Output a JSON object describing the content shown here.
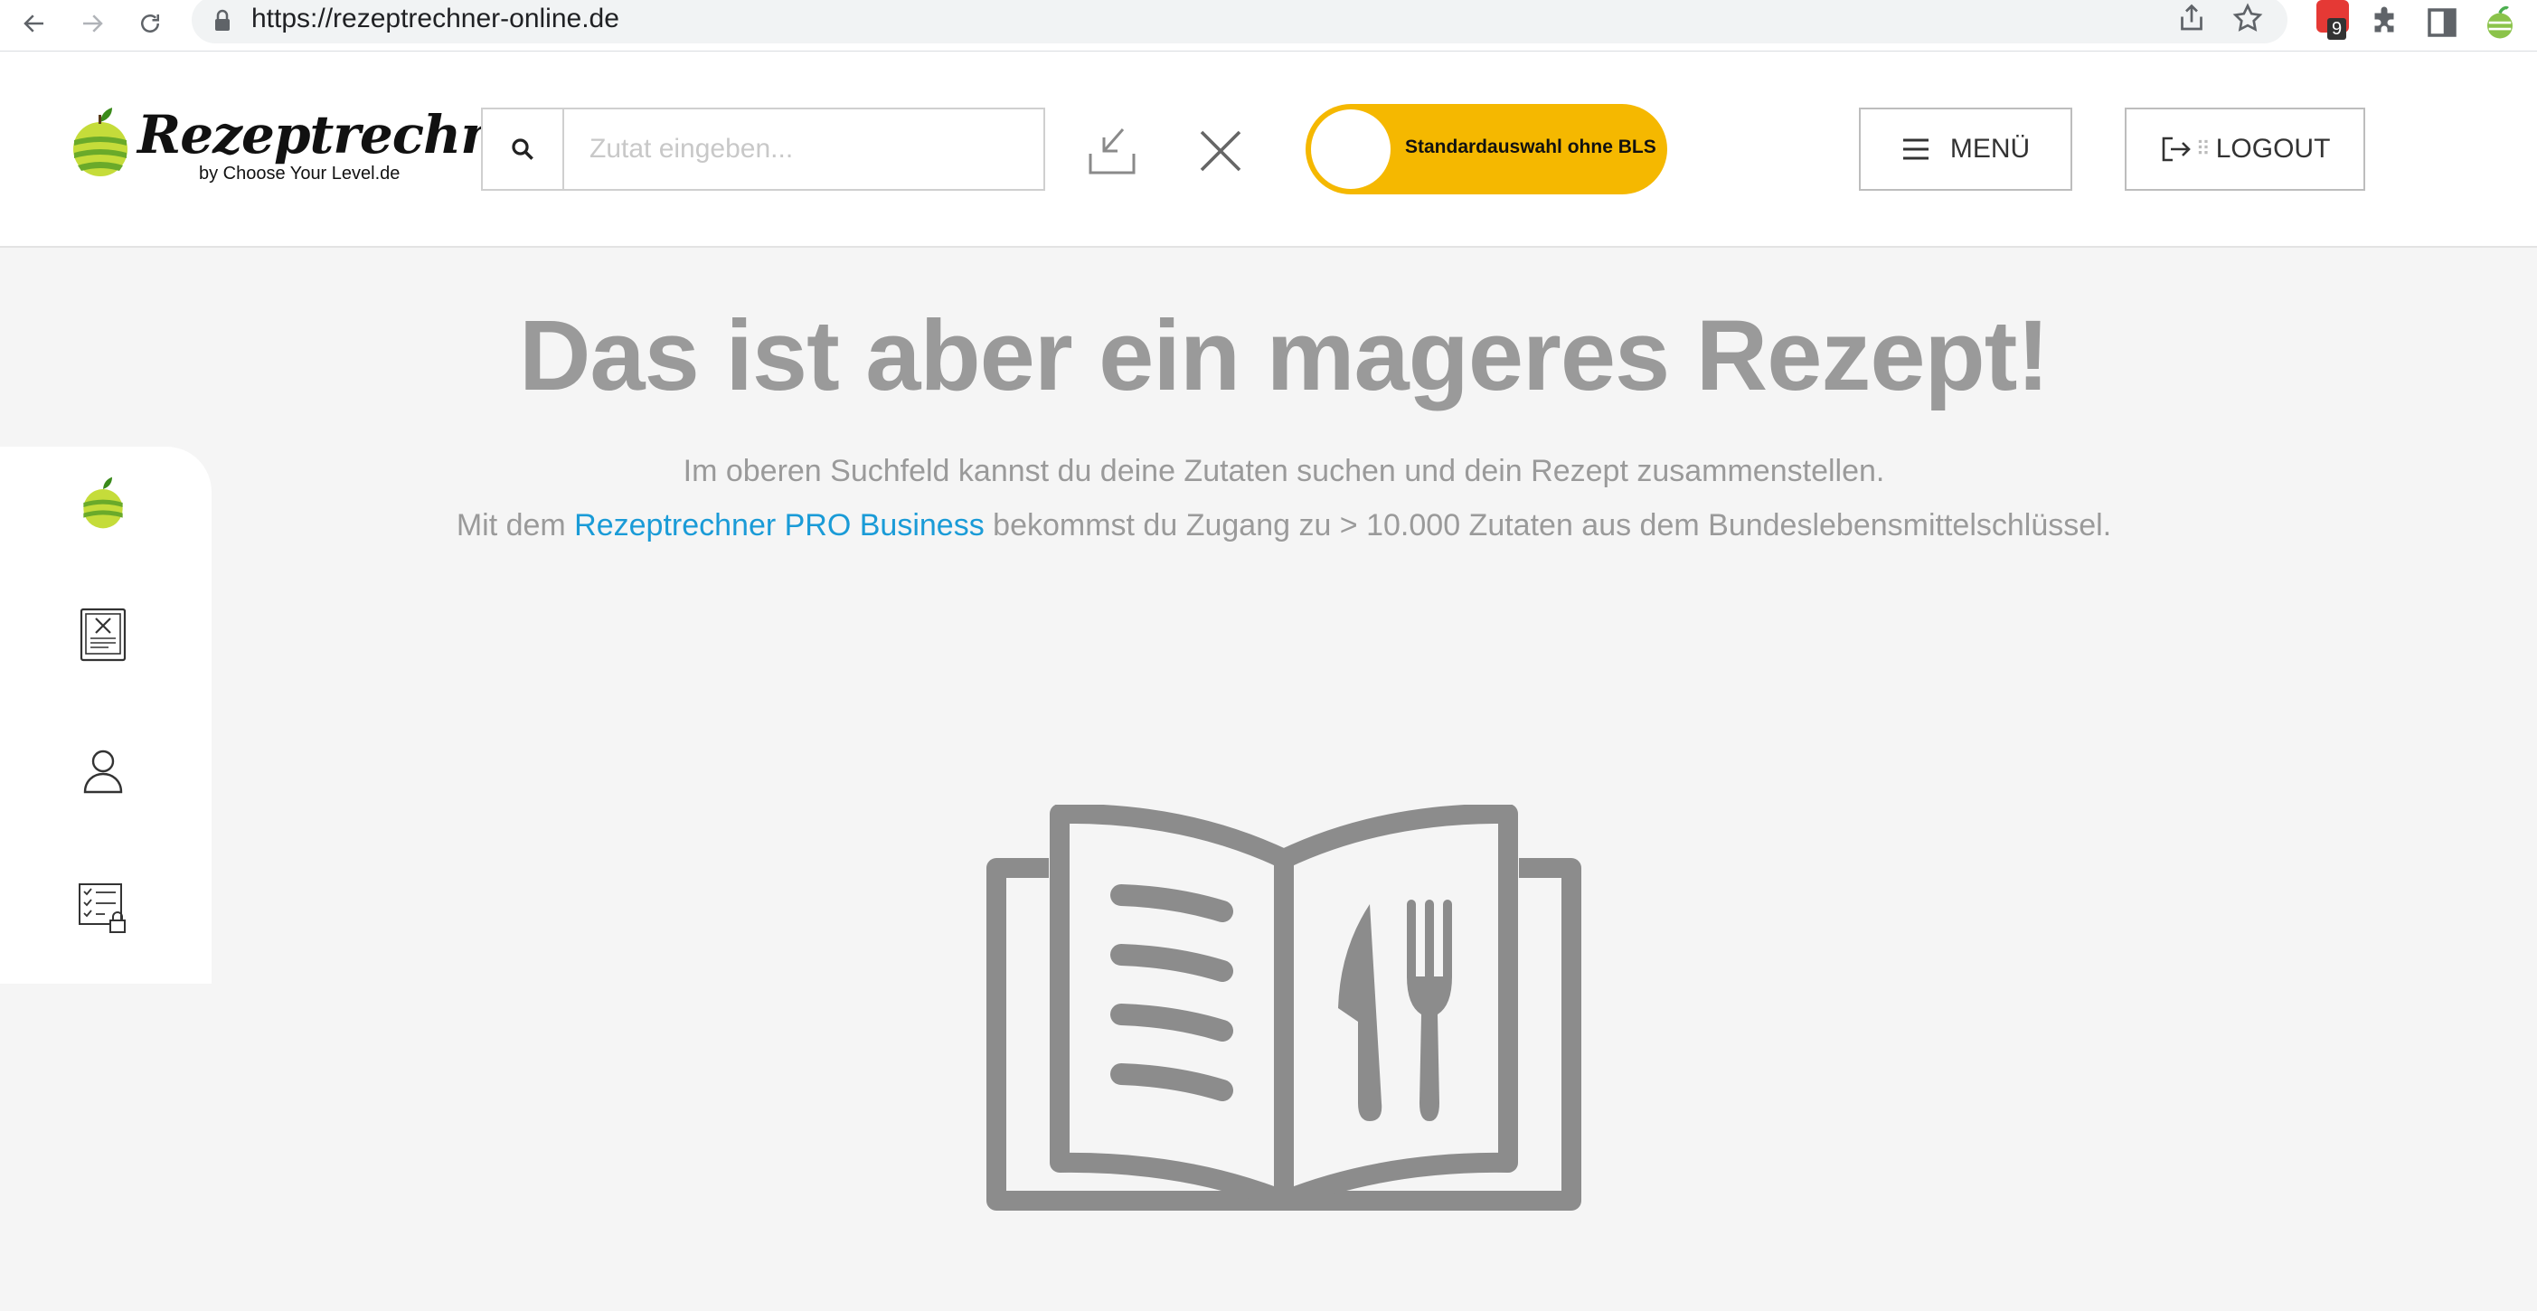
{
  "browser": {
    "url": "https://rezeptrechner-online.de",
    "extension_badge": "9"
  },
  "header": {
    "logo_title": "Rezeptrechner",
    "logo_subtitle": "by Choose Your Level.de",
    "search_placeholder": "Zutat eingeben...",
    "toggle_label": "Standardauswahl ohne BLS",
    "menu_label": "MENÜ",
    "logout_label": "LOGOUT"
  },
  "sidebar": {
    "items": [
      {
        "icon": "apple-logo-icon"
      },
      {
        "icon": "recipe-tablet-icon"
      },
      {
        "icon": "user-icon"
      },
      {
        "icon": "locked-checklist-icon"
      }
    ]
  },
  "main": {
    "headline": "Das ist aber ein mageres Rezept!",
    "line1": "Im oberen Suchfeld kannst du deine Zutaten suchen und dein Rezept zusammenstellen.",
    "line2_prefix": "Mit dem ",
    "line2_link": "Rezeptrechner PRO Business",
    "line2_suffix": " bekommst du Zugang zu > 10.000 Zutaten aus dem Bundeslebensmittelschlüssel."
  },
  "colors": {
    "accent_yellow": "#f5b800",
    "link_blue": "#1a9bd7",
    "muted_gray": "#9a9a9a",
    "background": "#f5f5f5"
  }
}
